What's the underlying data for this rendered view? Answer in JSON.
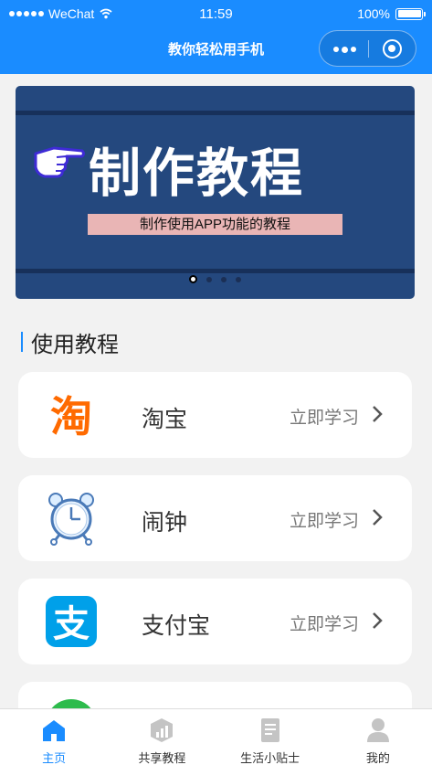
{
  "status_bar": {
    "carrier": "WeChat",
    "time": "11:59",
    "battery": "100%"
  },
  "nav": {
    "title": "教你轻松用手机"
  },
  "banner": {
    "headline": "制作教程",
    "subtitle": "制作使用APP功能的教程",
    "pages": 4,
    "active_page": 1
  },
  "section": {
    "title": "使用教程"
  },
  "tutorials": [
    {
      "name": "淘宝",
      "action": "立即学习",
      "icon": "taobao-icon"
    },
    {
      "name": "闹钟",
      "action": "立即学习",
      "icon": "alarm-clock-icon"
    },
    {
      "name": "支付宝",
      "action": "立即学习",
      "icon": "alipay-icon"
    },
    {
      "name": "",
      "action": "",
      "icon": "green-circle-icon"
    }
  ],
  "tabbar": [
    {
      "label": "主页",
      "icon": "home-icon",
      "active": true
    },
    {
      "label": "共享教程",
      "icon": "chart-icon",
      "active": false
    },
    {
      "label": "生活小贴士",
      "icon": "document-icon",
      "active": false
    },
    {
      "label": "我的",
      "icon": "user-icon",
      "active": false
    }
  ],
  "colors": {
    "primary": "#1a8cff",
    "banner_bg": "#24487e",
    "taobao": "#ff6a00",
    "alipay": "#00a0e9"
  }
}
